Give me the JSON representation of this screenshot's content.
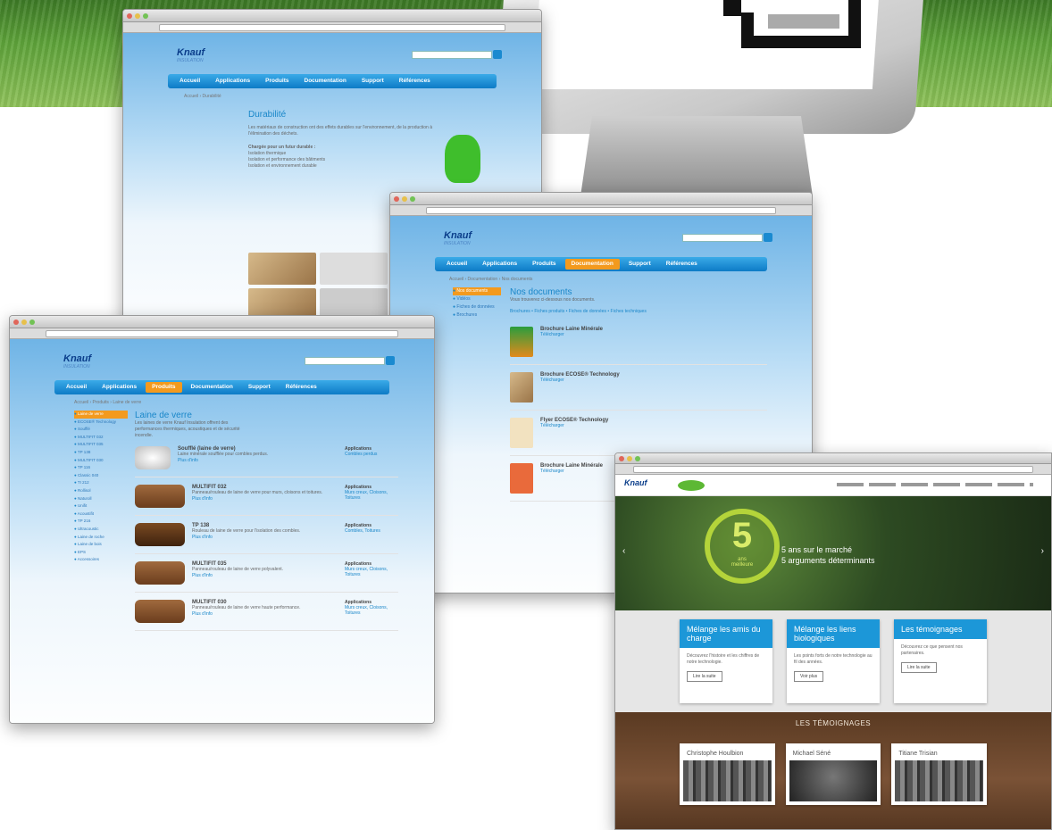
{
  "colors": {
    "accent": "#1a87c9",
    "nav_active": "#f39a1e",
    "green": "#3fbe2c"
  },
  "monitor": {
    "icon": "pixel-logo-icon"
  },
  "win_durabilite": {
    "title": "Durabilité",
    "crumb": "Accueil › Durabilité",
    "paragraph": "Les matériaux de construction ont des effets durables sur l'environnement, de la production à l'élimination des déchets.",
    "subhead": "Chargée pour un futur durable :",
    "bullets": [
      "Isolation thermique",
      "Isolation et performance des bâtiments",
      "Isolation et environnement durable"
    ]
  },
  "win_documents": {
    "title": "Nos documents",
    "crumb": "Accueil › Documentation › Nos documents",
    "intro": "Vous trouverez ci-dessous nos documents.",
    "sidebar": [
      "Nos documents",
      "Vidéos",
      "Fiches de données",
      "Brochures"
    ],
    "filter": "Brochures • Fiches produits • Fiches de données • Fiches techniques",
    "docs": [
      {
        "title": "Brochure Laine Minérale",
        "link": "Télécharger"
      },
      {
        "title": "Brochure ECOSE® Technology",
        "link": "Télécharger"
      },
      {
        "title": "Flyer ECOSE® Technology",
        "link": "Télécharger"
      },
      {
        "title": "Brochure Laine Minérale",
        "link": "Télécharger"
      }
    ]
  },
  "win_laine": {
    "title": "Laine de verre",
    "crumb": "Accueil › Produits › Laine de verre",
    "intro": "Les laines de verre Knauf Insulation offrent des performances thermiques, acoustiques et de sécurité incendie.",
    "sidebar": [
      "Laine de verre",
      "ECOSE® Technology",
      "Soufflé",
      "MULTIFIT 032",
      "MULTIFIT 035",
      "TP 138",
      "MULTIFIT 030",
      "TP 116",
      "Classic 040",
      "TI 212",
      "Rollisol",
      "Naturoll",
      "Unifit",
      "Acoustifit",
      "TP 216",
      "Ultracoustic",
      "Laine de roche",
      "Laine de bois",
      "EPS",
      "Accessoires"
    ],
    "products": [
      {
        "name": "Soufflé (laine de verre)",
        "text": "Laine minérale soufflée pour combles perdus.",
        "apps_title": "Applications",
        "apps": "Combles perdus",
        "more": "Plus d'info"
      },
      {
        "name": "MULTIFIT 032",
        "text": "Panneau/rouleau de laine de verre pour murs, cloisons et toitures.",
        "apps_title": "Applications",
        "apps": "Murs creux, Cloisons, Toitures",
        "more": "Plus d'info"
      },
      {
        "name": "TP 138",
        "text": "Rouleau de laine de verre pour l'isolation des combles.",
        "apps_title": "Applications",
        "apps": "Combles, Toitures",
        "more": "Plus d'info"
      },
      {
        "name": "MULTIFIT 035",
        "text": "Panneau/rouleau de laine de verre polyvalent.",
        "apps_title": "Applications",
        "apps": "Murs creux, Cloisons, Toitures",
        "more": "Plus d'info"
      },
      {
        "name": "MULTIFIT 030",
        "text": "Panneau/rouleau de laine de verre haute performance.",
        "apps_title": "Applications",
        "apps": "Murs creux, Cloisons, Toitures",
        "more": "Plus d'info"
      }
    ]
  },
  "nav": [
    "Accueil",
    "Applications",
    "Produits",
    "Documentation",
    "Support",
    "Références"
  ],
  "site": {
    "logo": "Knauf",
    "logo_sub": "INSULATION",
    "search_placeholder": "Recherche"
  },
  "win_ecose": {
    "hero_line1": "5 ans sur le marché",
    "hero_line2": "5 arguments déterminants",
    "badge_small": "ans",
    "badge_num": "5",
    "badge_line1": "la",
    "badge_line2": "meilleure",
    "badge_line3": "choix",
    "cards": [
      {
        "title": "Mélange les amis du charge",
        "text": "Découvrez l'histoire et les chiffres de notre technologie.",
        "btn": "Lire la suite"
      },
      {
        "title": "Mélange les liens biologiques",
        "text": "Les points forts de notre technologie au fil des années.",
        "btn": "Voir plus"
      },
      {
        "title": "Les témoignages",
        "text": "Découvrez ce que pensent nos partenaires.",
        "btn": "Lire la suite"
      }
    ],
    "testimonials_title": "LES TÉMOIGNAGES",
    "people": [
      "Christophe Houlbion",
      "Michael Séné",
      "Titiane Trisian"
    ]
  }
}
